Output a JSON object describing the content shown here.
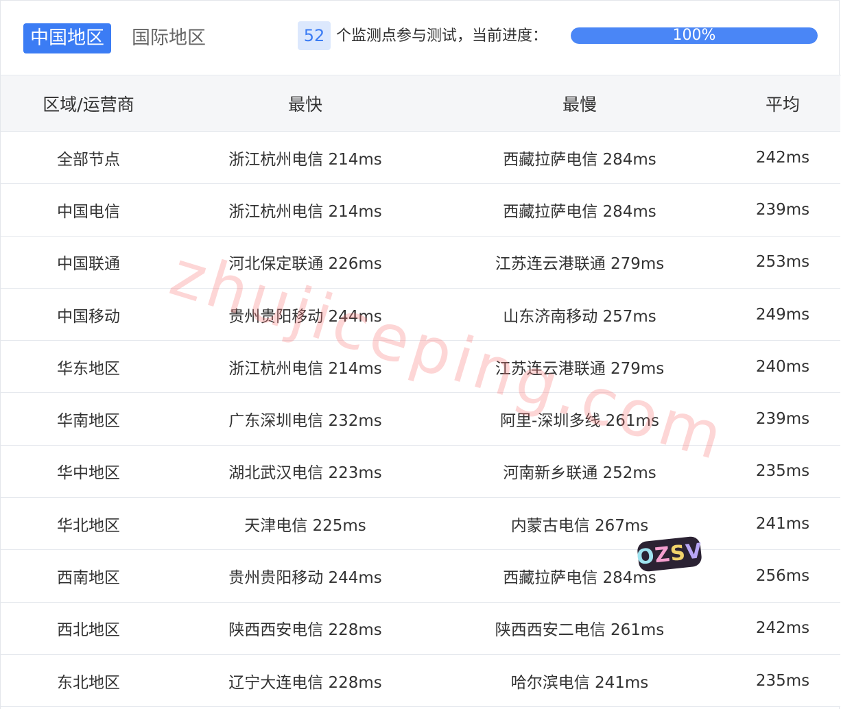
{
  "tabs": [
    {
      "label": "中国地区",
      "active": true
    },
    {
      "label": "国际地区",
      "active": false
    }
  ],
  "summary": {
    "count": "52",
    "text": "个监测点参与测试，当前进度：",
    "progress_label": "100%",
    "progress_value": 100
  },
  "table": {
    "headers": [
      "区域/运营商",
      "最快",
      "最慢",
      "平均"
    ],
    "rows": [
      {
        "region": "全部节点",
        "fastest": "浙江杭州电信 214ms",
        "slowest": "西藏拉萨电信 284ms",
        "average": "242ms"
      },
      {
        "region": "中国电信",
        "fastest": "浙江杭州电信 214ms",
        "slowest": "西藏拉萨电信 284ms",
        "average": "239ms"
      },
      {
        "region": "中国联通",
        "fastest": "河北保定联通 226ms",
        "slowest": "江苏连云港联通 279ms",
        "average": "253ms"
      },
      {
        "region": "中国移动",
        "fastest": "贵州贵阳移动 244ms",
        "slowest": "山东济南移动 257ms",
        "average": "249ms"
      },
      {
        "region": "华东地区",
        "fastest": "浙江杭州电信 214ms",
        "slowest": "江苏连云港联通 279ms",
        "average": "240ms"
      },
      {
        "region": "华南地区",
        "fastest": "广东深圳电信 232ms",
        "slowest": "阿里-深圳多线 261ms",
        "average": "239ms"
      },
      {
        "region": "华中地区",
        "fastest": "湖北武汉电信 223ms",
        "slowest": "河南新乡联通 252ms",
        "average": "235ms"
      },
      {
        "region": "华北地区",
        "fastest": "天津电信 225ms",
        "slowest": "内蒙古电信 267ms",
        "average": "241ms"
      },
      {
        "region": "西南地区",
        "fastest": "贵州贵阳移动 244ms",
        "slowest": "西藏拉萨电信 284ms",
        "average": "256ms"
      },
      {
        "region": "西北地区",
        "fastest": "陕西西安电信 228ms",
        "slowest": "陕西西安二电信 261ms",
        "average": "242ms"
      },
      {
        "region": "东北地区",
        "fastest": "辽宁大连电信 228ms",
        "slowest": "哈尔滨电信 241ms",
        "average": "235ms"
      }
    ]
  },
  "watermark": "zhujiceping.com",
  "sticker": "OZSV",
  "colors": {
    "accent": "#3b7cf4",
    "progress": "#4a86f6",
    "badge_bg": "#dce8fd",
    "header_bg": "#f5f6f8"
  }
}
